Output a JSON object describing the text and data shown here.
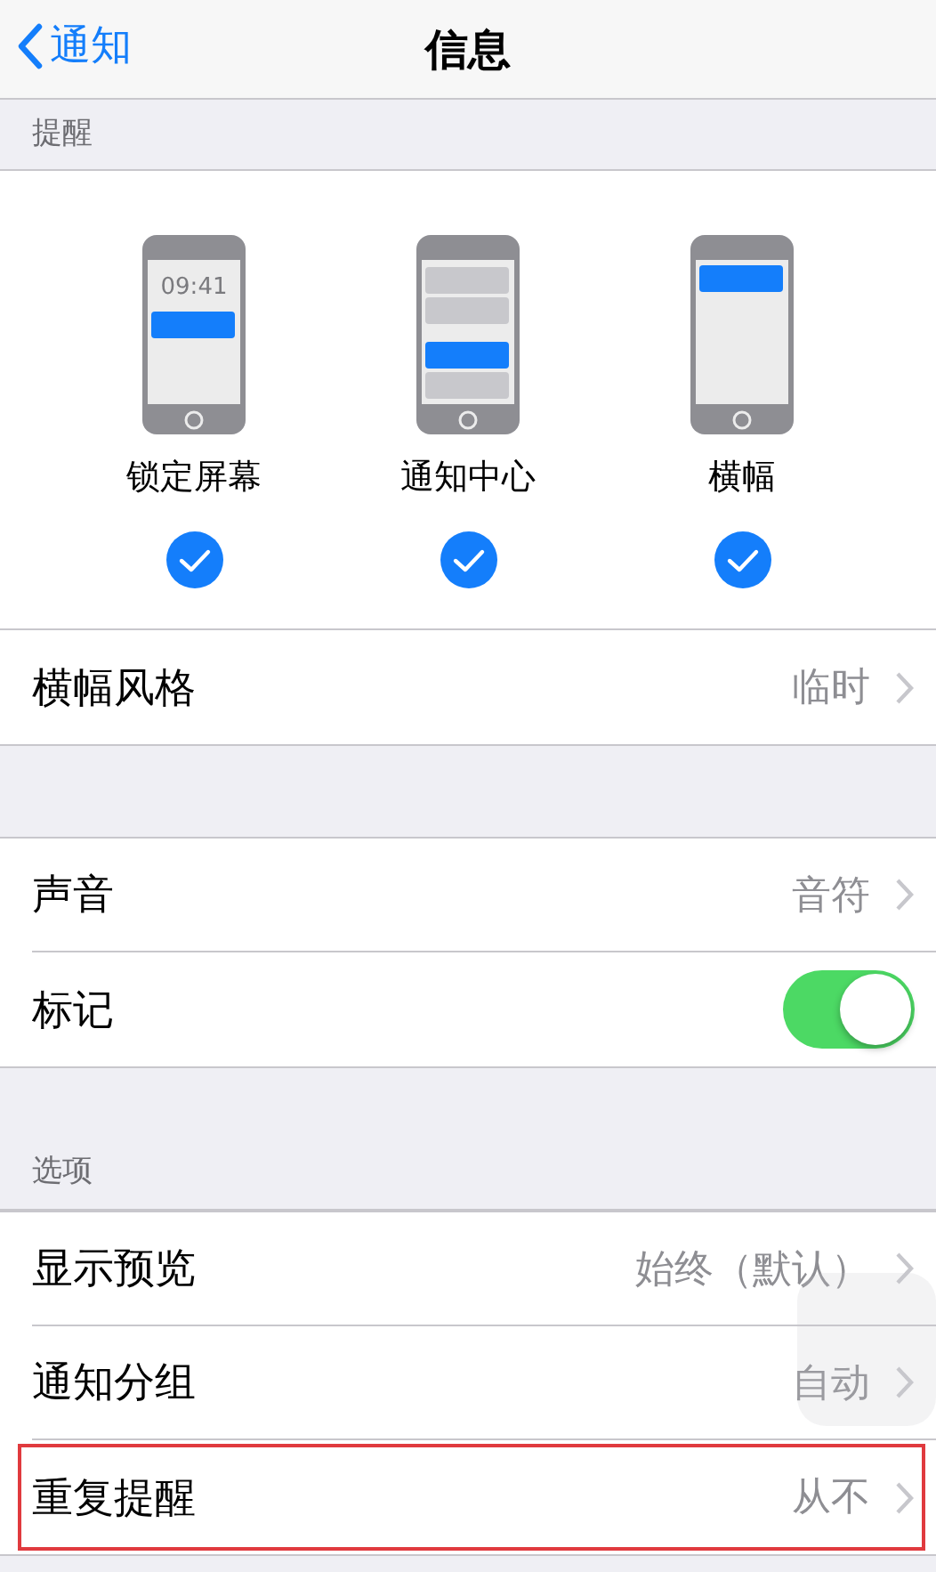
{
  "nav": {
    "back": "通知",
    "title": "信息"
  },
  "alerts": {
    "header": "提醒",
    "options": [
      {
        "kind": "lock_screen",
        "label": "锁定屏幕",
        "screen_time": "09:41",
        "checked": true
      },
      {
        "kind": "notification_center",
        "label": "通知中心",
        "checked": true
      },
      {
        "kind": "banner",
        "label": "横幅",
        "checked": true
      }
    ],
    "rows": [
      {
        "kind": "disclosure",
        "label": "横幅风格",
        "value": "临时",
        "highlighted": false
      }
    ]
  },
  "sound_group": {
    "rows": [
      {
        "kind": "disclosure",
        "label": "声音",
        "value": "音符",
        "highlighted": false
      },
      {
        "kind": "toggle",
        "label": "标记",
        "on": true,
        "highlighted": false
      }
    ]
  },
  "options": {
    "header": "选项",
    "rows": [
      {
        "kind": "disclosure",
        "label": "显示预览",
        "value": "始终（默认）",
        "highlighted": false
      },
      {
        "kind": "disclosure",
        "label": "通知分组",
        "value": "自动",
        "highlighted": false
      },
      {
        "kind": "disclosure",
        "label": "重复提醒",
        "value": "从不",
        "highlighted": true
      }
    ]
  }
}
